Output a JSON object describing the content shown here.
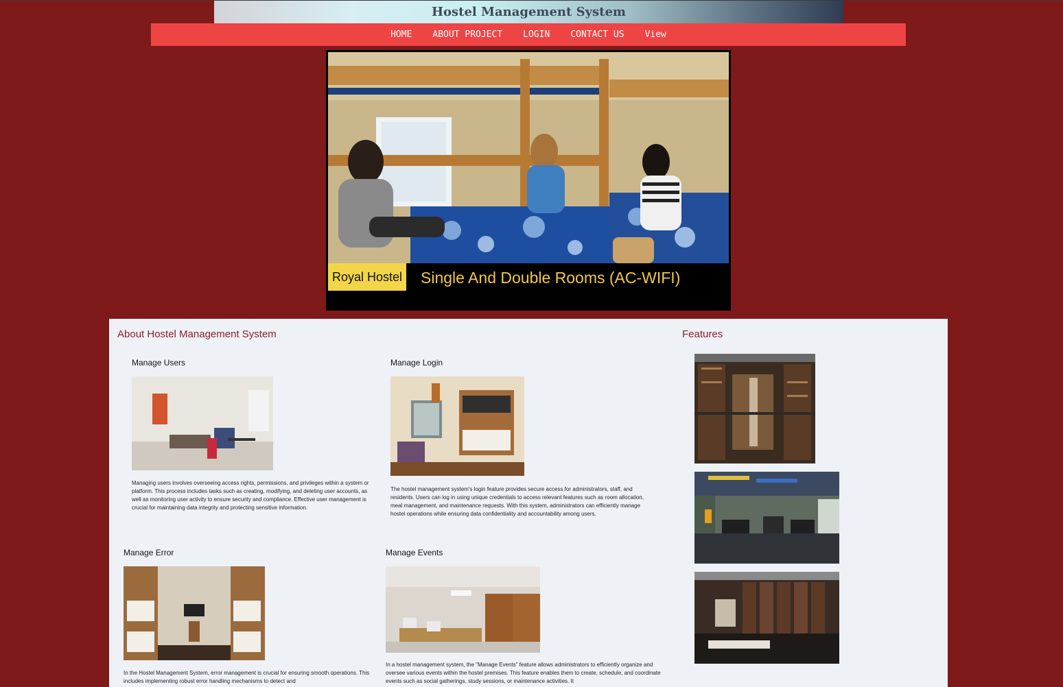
{
  "header": {
    "title": "Hostel Management System"
  },
  "nav": {
    "items": [
      "HOME",
      "ABOUT PROJECT",
      "LOGIN",
      "CONTACT US",
      "View"
    ]
  },
  "hero": {
    "tag": "Royal Hostel",
    "caption": "Single And Double Rooms (AC-WIFI)"
  },
  "about": {
    "heading": "About Hostel Management System",
    "cards": [
      {
        "title": "Manage Users",
        "text": "Managing users involves overseeing access rights, permissions, and privileges within a system or platform. This process includes tasks such as creating, modifying, and deleting user accounts, as well as monitoring user activity to ensure security and compliance. Effective user management is crucial for maintaining data integrity and protecting sensitive information."
      },
      {
        "title": "Manage Login",
        "text": "The hostel management system's login feature provides secure access for administrators, staff, and residents. Users can log in using unique credentials to access relevant features such as room allocation, meal management, and maintenance requests. With this system, administrators can efficiently manage hostel operations while ensuring data confidentiality and accountability among users."
      },
      {
        "title": "Manage Error",
        "text": "In the Hostel Management System, error management is crucial for ensuring smooth operations. This includes implementing robust error handling mechanisms to detect and"
      },
      {
        "title": "Manage Events",
        "text": "In a hostel management system, the \"Manage Events\" feature allows administrators to efficiently organize and oversee various events within the hostel premises. This feature enables them to create, schedule, and coordinate events such as social gatherings, study sessions, or maintenance activities. It"
      }
    ]
  },
  "features": {
    "heading": "Features"
  }
}
